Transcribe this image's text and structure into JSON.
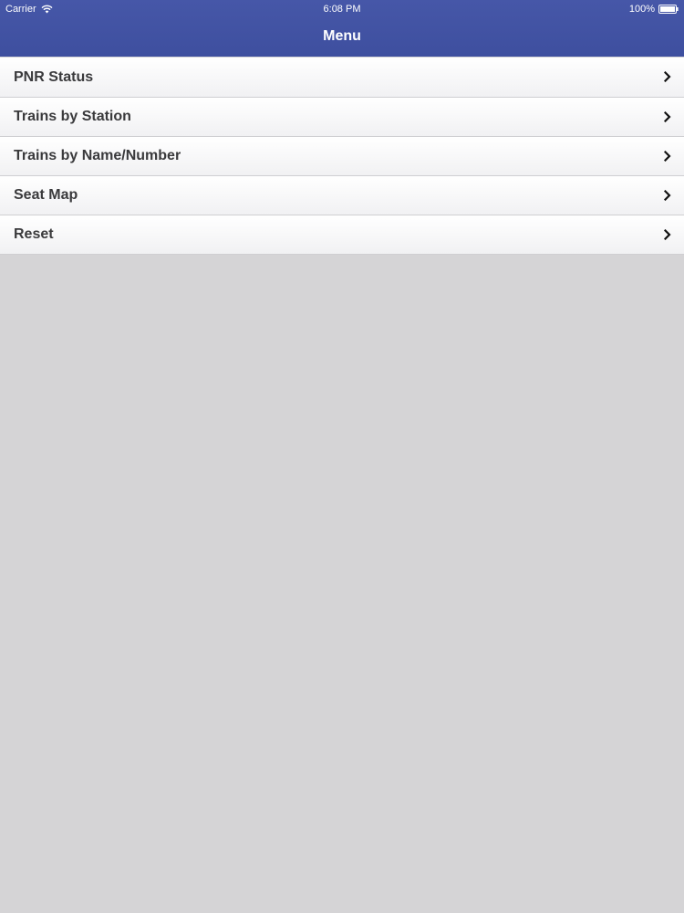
{
  "status_bar": {
    "carrier": "Carrier",
    "wifi_icon": "wifi-icon",
    "time": "6:08 PM",
    "battery_percent": "100%",
    "battery_icon": "battery-icon"
  },
  "nav_bar": {
    "title": "Menu",
    "color": "#4353a4"
  },
  "menu": {
    "items": [
      {
        "label": "PNR Status",
        "icon": "chevron-right-icon"
      },
      {
        "label": "Trains by Station",
        "icon": "chevron-right-icon"
      },
      {
        "label": "Trains by Name/Number",
        "icon": "chevron-right-icon"
      },
      {
        "label": "Seat Map",
        "icon": "chevron-right-icon"
      },
      {
        "label": "Reset",
        "icon": "chevron-right-icon"
      }
    ]
  },
  "background_color": "#d5d4d6"
}
